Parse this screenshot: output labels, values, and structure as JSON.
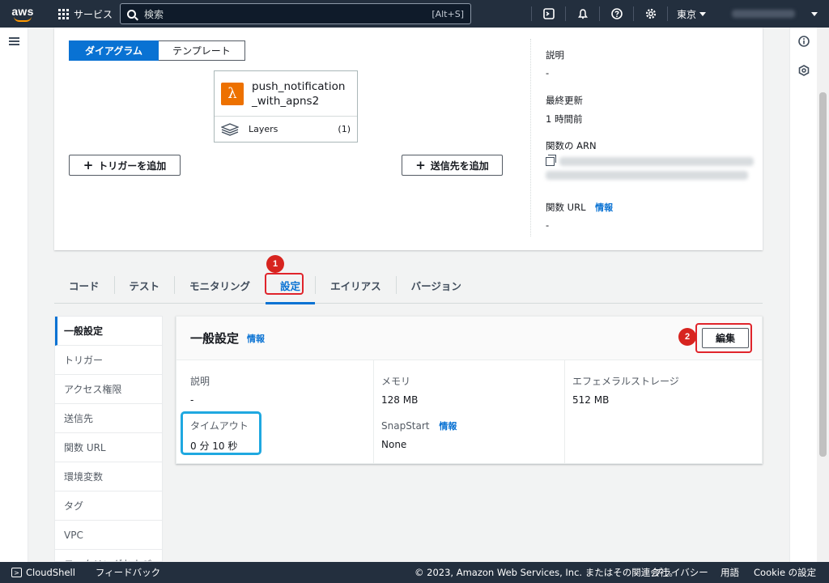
{
  "topnav": {
    "logo": "aws",
    "services_label": "サービス",
    "search_placeholder": "検索",
    "search_shortcut": "[Alt+S]",
    "region": "東京"
  },
  "diagram": {
    "tab_diagram": "ダイアグラム",
    "tab_template": "テンプレート",
    "function_name": "push_notification_with_apns2",
    "layers_label": "Layers",
    "layers_count": "(1)",
    "add_trigger": "トリガーを追加",
    "add_destination": "送信先を追加"
  },
  "meta": {
    "description_label": "説明",
    "description_value": "-",
    "last_modified_label": "最終更新",
    "last_modified_value": "1 時間前",
    "arn_label": "関数の ARN",
    "url_label": "関数 URL",
    "url_info": "情報",
    "url_value": "-"
  },
  "tabs": [
    {
      "label": "コード"
    },
    {
      "label": "テスト"
    },
    {
      "label": "モニタリング"
    },
    {
      "label": "設定"
    },
    {
      "label": "エイリアス"
    },
    {
      "label": "バージョン"
    }
  ],
  "sidenav": [
    {
      "label": "一般設定"
    },
    {
      "label": "トリガー"
    },
    {
      "label": "アクセス権限"
    },
    {
      "label": "送信先"
    },
    {
      "label": "関数 URL"
    },
    {
      "label": "環境変数"
    },
    {
      "label": "タグ"
    },
    {
      "label": "VPC"
    },
    {
      "label": "モニタリングおよび"
    }
  ],
  "general": {
    "title": "一般設定",
    "info": "情報",
    "edit": "編集",
    "description_label": "説明",
    "description_value": "-",
    "memory_label": "メモリ",
    "memory_value": "128 MB",
    "ephemeral_label": "エフェメラルストレージ",
    "ephemeral_value": "512 MB",
    "timeout_label": "タイムアウト",
    "timeout_value": "0 分 10 秒",
    "snapstart_label": "SnapStart",
    "snapstart_info": "情報",
    "snapstart_value": "None"
  },
  "annotations": {
    "badge1": "1",
    "badge2": "2"
  },
  "footer": {
    "cloudshell": "CloudShell",
    "feedback": "フィードバック",
    "copyright": "© 2023, Amazon Web Services, Inc. またはその関連会社。",
    "privacy": "プライバシー",
    "terms": "用語",
    "cookie": "Cookie の設定"
  },
  "colors": {
    "nav_bg": "#232f3e",
    "accent": "#0972d3",
    "lambda": "#ed7100",
    "annotation_red": "#e0242b",
    "annotation_blue": "#1fa8e0"
  }
}
